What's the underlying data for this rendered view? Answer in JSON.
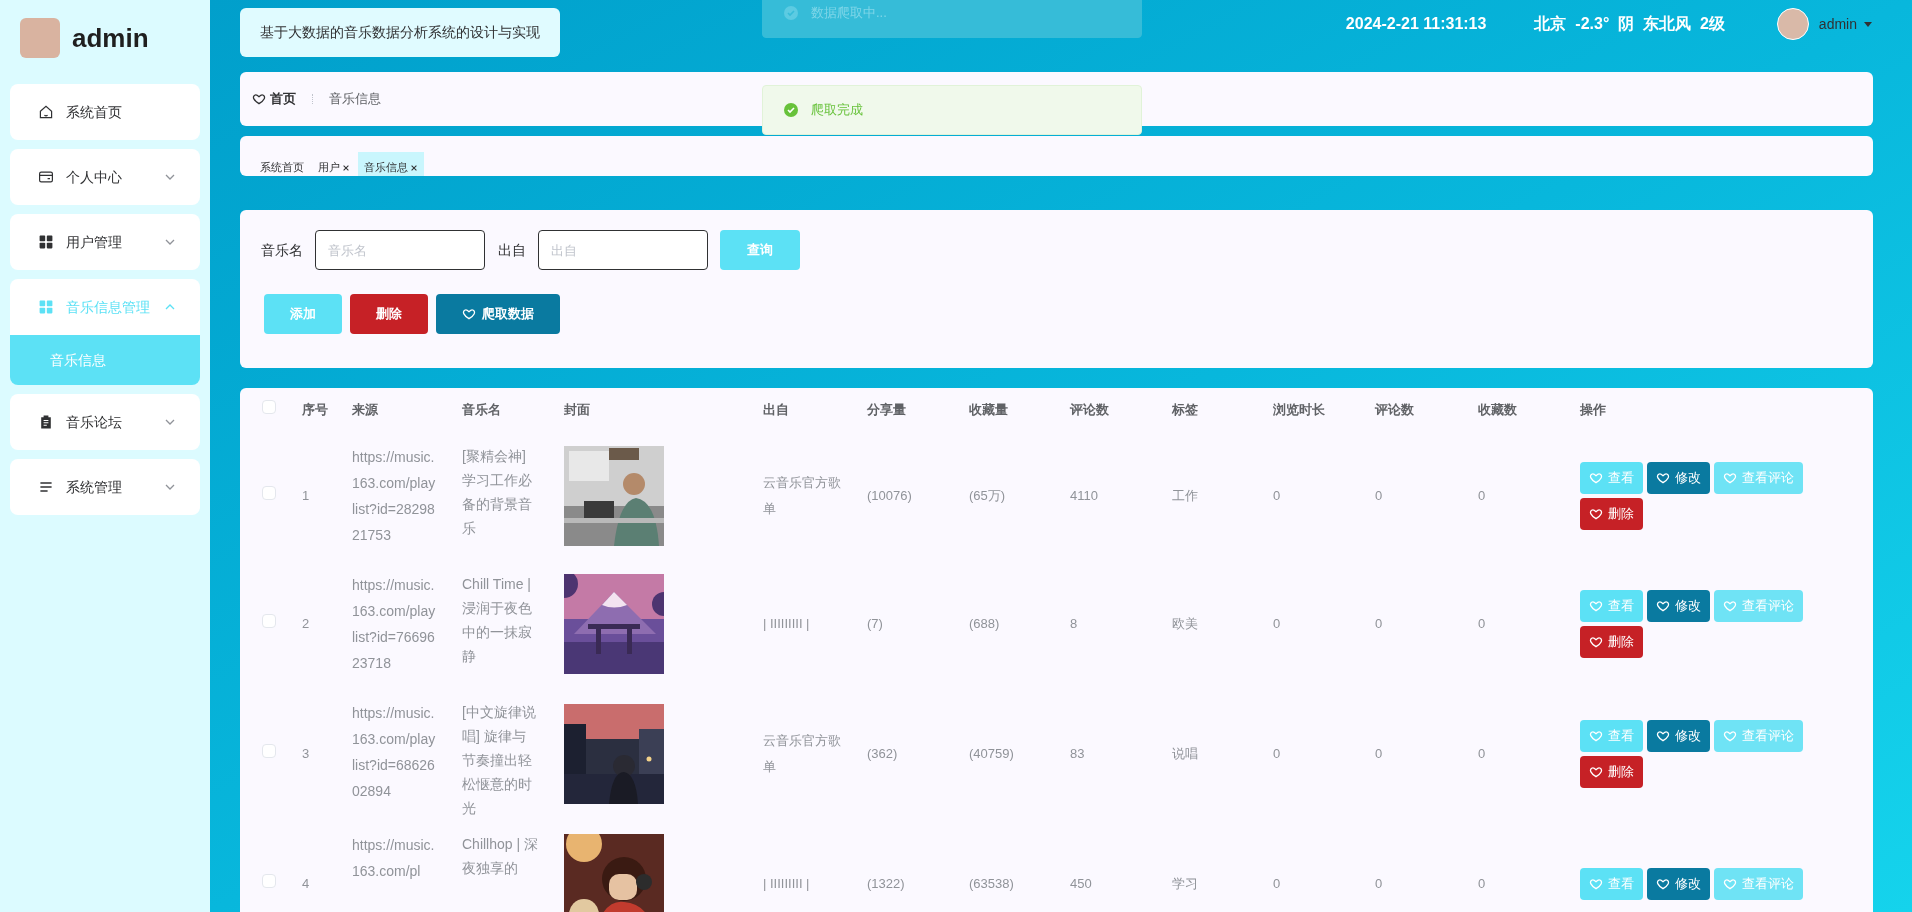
{
  "sidebar": {
    "title": "admin",
    "menu": [
      {
        "label": "系统首页",
        "kind": "link"
      },
      {
        "label": "个人中心",
        "kind": "group",
        "expanded": false
      },
      {
        "label": "用户管理",
        "kind": "group",
        "expanded": false
      },
      {
        "label": "音乐信息管理",
        "kind": "group",
        "expanded": true,
        "children": [
          {
            "label": "音乐信息",
            "selected": true
          }
        ]
      },
      {
        "label": "音乐论坛",
        "kind": "group",
        "expanded": false
      },
      {
        "label": "系统管理",
        "kind": "group",
        "expanded": false
      }
    ]
  },
  "header": {
    "title": "基于大数据的音乐数据分析系统的设计与实现",
    "datetime": "2024-2-21 11:31:13",
    "weather": "北京  -2.3°  阴  东北风  2级",
    "user": "admin"
  },
  "toasts": [
    {
      "text": "数据爬取中...",
      "fading": true
    },
    {
      "text": "爬取完成",
      "fading": false
    }
  ],
  "breadcrumb": [
    "首页",
    "音乐信息"
  ],
  "tags": [
    {
      "label": "系统首页",
      "closable": false,
      "selected": false
    },
    {
      "label": "用户",
      "closable": true,
      "selected": false
    },
    {
      "label": "音乐信息",
      "closable": true,
      "selected": true
    }
  ],
  "search": {
    "fields": [
      {
        "label": "音乐名",
        "placeholder": "音乐名"
      },
      {
        "label": "出自",
        "placeholder": "出自"
      }
    ],
    "button": "查询"
  },
  "actions": [
    {
      "label": "添加",
      "kind": "add"
    },
    {
      "label": "删除",
      "kind": "delete"
    },
    {
      "label": "爬取数据",
      "kind": "crawl"
    }
  ],
  "table": {
    "header_checked": false,
    "columns": [
      "序号",
      "来源",
      "音乐名",
      "封面",
      "出自",
      "分享量",
      "收藏量",
      "评论数",
      "标签",
      "浏览时长",
      "评论数",
      "收藏数",
      "操作"
    ],
    "rows": [
      {
        "checked": false,
        "index": "1",
        "source": "https://music.163.com/playlist?id=2829821753",
        "name": "[聚精会神]学习工作必备的背景音乐",
        "from": "云音乐官方歌单",
        "shares": "(10076)",
        "favorites": "(65万)",
        "comments": "4110",
        "tag": "工作",
        "browse": "0",
        "comment_count": "0",
        "favorite_count": "0",
        "buttons": [
          {
            "label": "查看",
            "kind": "view"
          },
          {
            "label": "修改",
            "kind": "edit"
          },
          {
            "label": "查看评论",
            "kind": "comments"
          },
          {
            "label": "删除",
            "kind": "delete"
          }
        ]
      },
      {
        "checked": false,
        "index": "2",
        "source": "https://music.163.com/playlist?id=7669623718",
        "name": "Chill Time | 浸润于夜色中的一抹寂静",
        "from": "| IIIIIIIII |",
        "shares": "(7)",
        "favorites": "(688)",
        "comments": "8",
        "tag": "欧美",
        "browse": "0",
        "comment_count": "0",
        "favorite_count": "0",
        "buttons": [
          {
            "label": "查看",
            "kind": "view"
          },
          {
            "label": "修改",
            "kind": "edit"
          },
          {
            "label": "查看评论",
            "kind": "comments"
          },
          {
            "label": "删除",
            "kind": "delete"
          }
        ]
      },
      {
        "checked": false,
        "index": "3",
        "source": "https://music.163.com/playlist?id=6862602894",
        "name": "[中文旋律说唱] 旋律与节奏撞出轻松惬意的时光",
        "from": "云音乐官方歌单",
        "shares": "(362)",
        "favorites": "(40759)",
        "comments": "83",
        "tag": "说唱",
        "browse": "0",
        "comment_count": "0",
        "favorite_count": "0",
        "buttons": [
          {
            "label": "查看",
            "kind": "view"
          },
          {
            "label": "修改",
            "kind": "edit"
          },
          {
            "label": "查看评论",
            "kind": "comments"
          },
          {
            "label": "删除",
            "kind": "delete"
          }
        ]
      },
      {
        "checked": false,
        "index": "4",
        "source": "https://music.163.com/pl",
        "name": "Chillhop | 深夜独享的",
        "from": "| IIIIIIIII |",
        "shares": "(1322)",
        "favorites": "(63538)",
        "comments": "450",
        "tag": "学习",
        "browse": "0",
        "comment_count": "0",
        "favorite_count": "0",
        "buttons": [
          {
            "label": "查看",
            "kind": "view"
          },
          {
            "label": "修改",
            "kind": "edit"
          },
          {
            "label": "查看评论",
            "kind": "comments"
          }
        ]
      }
    ]
  }
}
